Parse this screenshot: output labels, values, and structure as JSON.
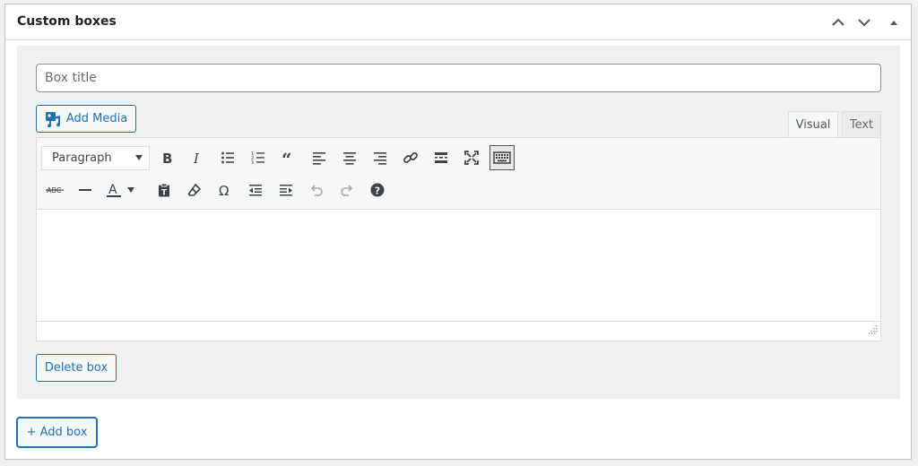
{
  "postbox": {
    "title": "Custom boxes",
    "controls": {
      "move_up": "chevron-up-icon",
      "move_down": "chevron-down-icon",
      "toggle": "triangle-up-icon"
    }
  },
  "box": {
    "title_placeholder": "Box title",
    "title_value": "",
    "add_media_label": "Add Media",
    "tabs": [
      "Visual",
      "Text"
    ],
    "active_tab": "Visual",
    "format_select": "Paragraph",
    "toolbar_row1": [
      "bold",
      "italic",
      "bulleted-list",
      "numbered-list",
      "blockquote",
      "align-left",
      "align-center",
      "align-right",
      "insert-link",
      "read-more",
      "fullscreen",
      "toolbar-toggle"
    ],
    "toolbar_row2": [
      "strikethrough",
      "horizontal-line",
      "text-color",
      "paste-as-text",
      "clear-formatting",
      "special-character",
      "decrease-indent",
      "increase-indent",
      "undo",
      "redo",
      "help"
    ],
    "delete_label": "Delete box"
  },
  "add_box_label": "+ Add box",
  "colors": {
    "accent": "#2271b1",
    "border": "#c3c4c7",
    "panel_bg": "#f0f0f1"
  }
}
